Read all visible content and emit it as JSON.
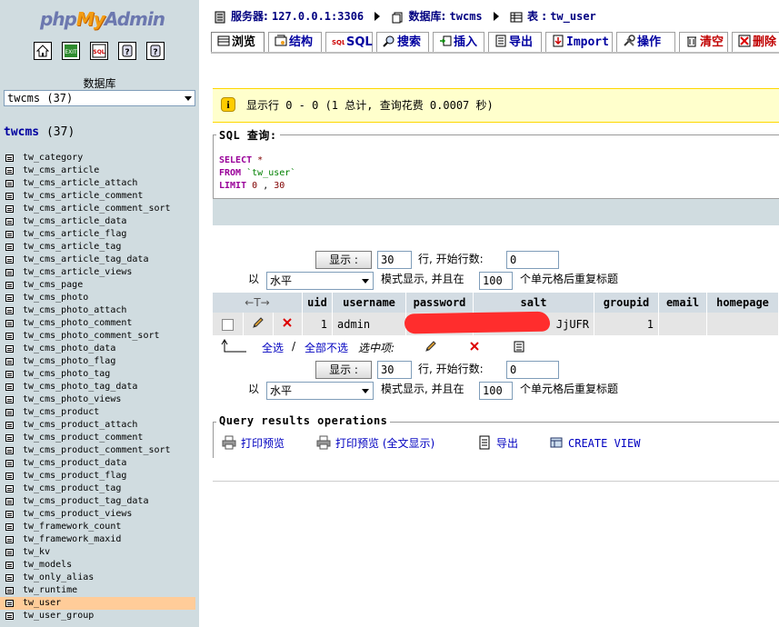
{
  "logo": {
    "php": "php",
    "my": "My",
    "admin": "Admin"
  },
  "quick_icons": [
    "home-icon",
    "exit-icon",
    "sql-query-icon",
    "docs-icon",
    "sql-docs-icon"
  ],
  "sidebar": {
    "db_label": "数据库",
    "db_selected": "twcms (37)",
    "db_name": "twcms",
    "db_count": "(37)",
    "tables": [
      "tw_category",
      "tw_cms_article",
      "tw_cms_article_attach",
      "tw_cms_article_comment",
      "tw_cms_article_comment_sort",
      "tw_cms_article_data",
      "tw_cms_article_flag",
      "tw_cms_article_tag",
      "tw_cms_article_tag_data",
      "tw_cms_article_views",
      "tw_cms_page",
      "tw_cms_photo",
      "tw_cms_photo_attach",
      "tw_cms_photo_comment",
      "tw_cms_photo_comment_sort",
      "tw_cms_photo_data",
      "tw_cms_photo_flag",
      "tw_cms_photo_tag",
      "tw_cms_photo_tag_data",
      "tw_cms_photo_views",
      "tw_cms_product",
      "tw_cms_product_attach",
      "tw_cms_product_comment",
      "tw_cms_product_comment_sort",
      "tw_cms_product_data",
      "tw_cms_product_flag",
      "tw_cms_product_tag",
      "tw_cms_product_tag_data",
      "tw_cms_product_views",
      "tw_framework_count",
      "tw_framework_maxid",
      "tw_kv",
      "tw_models",
      "tw_only_alias",
      "tw_runtime",
      "tw_user",
      "tw_user_group"
    ],
    "active_table": "tw_user",
    "active_color": "#ffcc99"
  },
  "breadcrumb": {
    "server_label": "服务器:",
    "server": "127.0.0.1:3306",
    "db_label": "数据库:",
    "db": "twcms",
    "table_label": "表 :",
    "table": "tw_user"
  },
  "tabs": [
    {
      "label": "浏览",
      "icon": "browse-icon"
    },
    {
      "label": "结构",
      "icon": "structure-icon"
    },
    {
      "label": "SQL",
      "icon": "sql-icon"
    },
    {
      "label": "搜索",
      "icon": "search-icon"
    },
    {
      "label": "插入",
      "icon": "insert-icon"
    },
    {
      "label": "导出",
      "icon": "export-icon"
    },
    {
      "label": "Import",
      "icon": "import-icon"
    },
    {
      "label": "操作",
      "icon": "operations-icon"
    },
    {
      "label": "清空",
      "icon": "empty-icon"
    },
    {
      "label": "删除",
      "icon": "drop-icon"
    }
  ],
  "notice": {
    "text": "显示行 0 - 0 (1 总计, 查询花费 0.0007 秒)"
  },
  "sql": {
    "legend": "SQL 查询:",
    "select": "SELECT",
    "star": "*",
    "from": "FROM",
    "table": "`tw_user`",
    "limit": "LIMIT",
    "offset": "0",
    "comma": ",",
    "count": "30"
  },
  "nav": {
    "show_button": "显示 :",
    "rows": "30",
    "start_label": "行, 开始行数:",
    "start": "0",
    "in_label": "以",
    "mode": "水平",
    "mode_label": "模式显示, 并且在",
    "repeat": "100",
    "repeat_label": "个单元格后重复标题"
  },
  "table": {
    "sort_arrows": "←T→",
    "columns": [
      "uid",
      "username",
      "password",
      "salt",
      "groupid",
      "email",
      "homepage"
    ],
    "rows": [
      {
        "uid": "1",
        "username": "admin",
        "password": "",
        "salt": "JjUFR",
        "groupid": "1",
        "email": "",
        "homepage": ""
      }
    ]
  },
  "with_selected": {
    "check_all": "全选",
    "slash": "/",
    "uncheck_all": "全部不选",
    "label": "选中项:"
  },
  "operations": {
    "legend": "Query results operations",
    "print": "打印预览",
    "print_full": "打印预览 (全文显示)",
    "export": "导出",
    "create_view": "CREATE VIEW"
  }
}
